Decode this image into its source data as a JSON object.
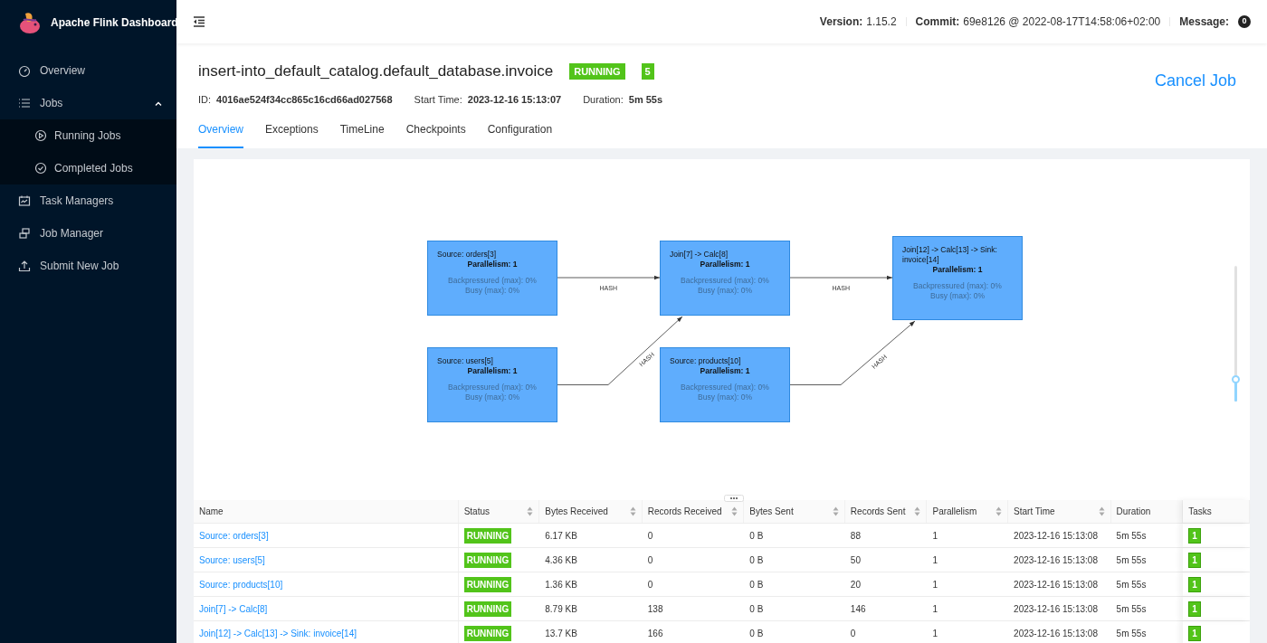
{
  "app": {
    "title": "Apache Flink Dashboard"
  },
  "sidebar": {
    "items": [
      {
        "label": "Overview"
      },
      {
        "label": "Jobs",
        "expanded": true,
        "children": [
          {
            "label": "Running Jobs"
          },
          {
            "label": "Completed Jobs"
          }
        ]
      },
      {
        "label": "Task Managers"
      },
      {
        "label": "Job Manager"
      },
      {
        "label": "Submit New Job"
      }
    ]
  },
  "header": {
    "info": [
      {
        "label": "Version:",
        "value": "1.15.2"
      },
      {
        "label": "Commit:",
        "value": "69e8126 @ 2022-08-17T14:58:06+02:00"
      },
      {
        "label": "Message:",
        "badge": "0"
      }
    ]
  },
  "job": {
    "name": "insert-into_default_catalog.default_database.invoice",
    "status": "RUNNING",
    "task_count": "5",
    "meta": [
      {
        "label": "ID:",
        "value": "4016ae524f34cc865c16cd66ad027568"
      },
      {
        "label": "Start Time:",
        "value": "2023-12-16 15:13:07"
      },
      {
        "label": "Duration:",
        "value": "5m 55s"
      }
    ],
    "cancel": "Cancel Job"
  },
  "tabs": [
    {
      "label": "Overview",
      "selected": true
    },
    {
      "label": "Exceptions",
      "selected": false
    },
    {
      "label": "TimeLine",
      "selected": false
    },
    {
      "label": "Checkpoints",
      "selected": false
    },
    {
      "label": "Configuration",
      "selected": false
    }
  ],
  "graph": {
    "nodes": [
      {
        "name": "Source: orders[3]",
        "parallelism": "Parallelism: 1",
        "backpressured": "Backpressured (max): 0%",
        "busy": "Busy (max): 0%"
      },
      {
        "name": "Join[7] -> Calc[8]",
        "parallelism": "Parallelism: 1",
        "backpressured": "Backpressured (max): 0%",
        "busy": "Busy (max): 0%"
      },
      {
        "name": "Join[12] -> Calc[13] -> Sink: invoice[14]",
        "parallelism": "Parallelism: 1",
        "backpressured": "Backpressured (max): 0%",
        "busy": "Busy (max): 0%"
      },
      {
        "name": "Source: users[5]",
        "parallelism": "Parallelism: 1",
        "backpressured": "Backpressured (max): 0%",
        "busy": "Busy (max): 0%"
      },
      {
        "name": "Source: products[10]",
        "parallelism": "Parallelism: 1",
        "backpressured": "Backpressured (max): 0%",
        "busy": "Busy (max): 0%"
      }
    ],
    "edges": [
      {
        "label": "HASH"
      },
      {
        "label": "HASH"
      },
      {
        "label": "HASH"
      },
      {
        "label": "HASH"
      }
    ],
    "zoom": {
      "level": 0.17
    }
  },
  "table": {
    "columns": [
      {
        "label": "Name",
        "sortable": false
      },
      {
        "label": "Status",
        "sortable": true
      },
      {
        "label": "Bytes Received",
        "sortable": true
      },
      {
        "label": "Records Received",
        "sortable": true
      },
      {
        "label": "Bytes Sent",
        "sortable": true
      },
      {
        "label": "Records Sent",
        "sortable": true
      },
      {
        "label": "Parallelism",
        "sortable": true
      },
      {
        "label": "Start Time",
        "sortable": true
      },
      {
        "label": "Duration",
        "sortable": false
      },
      {
        "label": "Tasks",
        "sortable": false
      }
    ],
    "rows": [
      [
        "Source: orders[3]",
        "RUNNING",
        "6.17 KB",
        "0",
        "0 B",
        "88",
        "1",
        "2023-12-16 15:13:08",
        "5m 55s",
        "1"
      ],
      [
        "Source: users[5]",
        "RUNNING",
        "4.36 KB",
        "0",
        "0 B",
        "50",
        "1",
        "2023-12-16 15:13:08",
        "5m 55s",
        "1"
      ],
      [
        "Source: products[10]",
        "RUNNING",
        "1.36 KB",
        "0",
        "0 B",
        "20",
        "1",
        "2023-12-16 15:13:08",
        "5m 55s",
        "1"
      ],
      [
        "Join[7] -> Calc[8]",
        "RUNNING",
        "8.79 KB",
        "138",
        "0 B",
        "146",
        "1",
        "2023-12-16 15:13:08",
        "5m 55s",
        "1"
      ],
      [
        "Join[12] -> Calc[13] -> Sink: invoice[14]",
        "RUNNING",
        "13.7 KB",
        "166",
        "0 B",
        "0",
        "1",
        "2023-12-16 15:13:08",
        "5m 55s",
        "1"
      ]
    ]
  }
}
